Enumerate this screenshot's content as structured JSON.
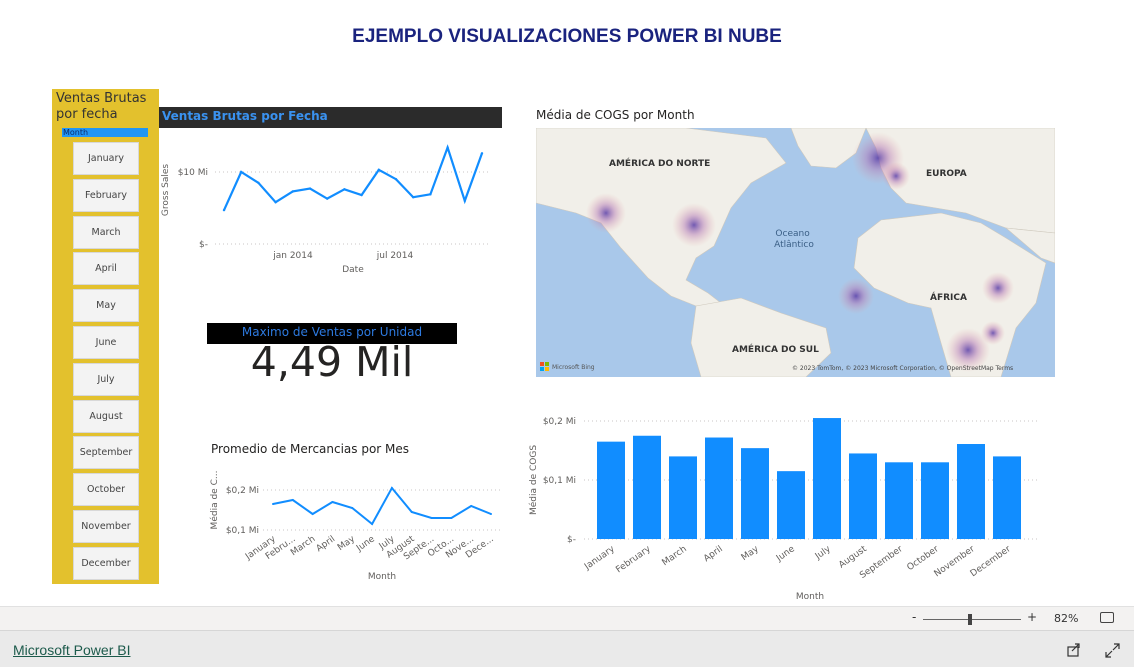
{
  "page_title": "EJEMPLO VISUALIZACIONES POWER BI NUBE",
  "slicer": {
    "title": "Ventas Brutas por fecha",
    "header": "Month",
    "items": [
      "January",
      "February",
      "March",
      "April",
      "May",
      "June",
      "July",
      "August",
      "September",
      "October",
      "November",
      "December"
    ]
  },
  "line_chart": {
    "title": "Ventas Brutas por Fecha",
    "ylabel": "Gross Sales",
    "xlabel": "Date",
    "y_ticks": [
      "$10 Mi",
      "$-"
    ],
    "x_ticks": [
      "jan 2014",
      "jul 2014"
    ]
  },
  "kpi": {
    "title": "Maximo de Ventas por Unidad",
    "value": "4,49 Mil"
  },
  "small_line": {
    "title": "Promedio de Mercancias por Mes",
    "ylabel": "Média de C...",
    "xlabel": "Month",
    "y_ticks": [
      "$0,2 Mi",
      "$0,1 Mi"
    ],
    "x_ticks": [
      "January",
      "Febru...",
      "March",
      "April",
      "May",
      "June",
      "July",
      "August",
      "Septe...",
      "Octo...",
      "Nove...",
      "Dece..."
    ]
  },
  "map": {
    "title": "Média de COGS por Month",
    "labels": {
      "north_america": "AMÉRICA DO NORTE",
      "europe": "EUROPA",
      "ocean": "Oceano Atlântico",
      "africa": "ÁFRICA",
      "south_america": "AMÉRICA DO SUL"
    },
    "bing": "Microsoft Bing",
    "attribution": "© 2023 TomTom, © 2023 Microsoft Corporation, © OpenStreetMap  Terms"
  },
  "bar_chart": {
    "ylabel": "Média de COGS",
    "xlabel": "Month",
    "y_ticks": [
      "$0,2 Mi",
      "$0,1 Mi",
      "$-"
    ]
  },
  "chart_data": [
    {
      "type": "line",
      "title": "Ventas Brutas por Fecha",
      "xlabel": "Date",
      "ylabel": "Gross Sales",
      "ylim": [
        0,
        14
      ],
      "x": [
        "2013-09",
        "2013-10",
        "2013-11",
        "2013-12",
        "2014-01",
        "2014-02",
        "2014-03",
        "2014-04",
        "2014-05",
        "2014-06",
        "2014-07",
        "2014-08",
        "2014-09",
        "2014-10",
        "2014-11",
        "2014-12",
        "2015-01"
      ],
      "values": [
        4.7,
        10.0,
        8.5,
        5.8,
        7.3,
        7.7,
        6.3,
        7.6,
        6.8,
        10.3,
        9.0,
        6.5,
        6.9,
        13.4,
        6.0,
        12.6
      ]
    },
    {
      "type": "line",
      "title": "Promedio de Mercancias por Mes",
      "xlabel": "Month",
      "ylabel": "Média de C...",
      "ylim": [
        0.08,
        0.22
      ],
      "categories": [
        "January",
        "February",
        "March",
        "April",
        "May",
        "June",
        "July",
        "August",
        "September",
        "October",
        "November",
        "December"
      ],
      "values": [
        0.165,
        0.175,
        0.14,
        0.17,
        0.155,
        0.115,
        0.205,
        0.145,
        0.13,
        0.13,
        0.16,
        0.14
      ]
    },
    {
      "type": "bar",
      "title": "",
      "xlabel": "Month",
      "ylabel": "Média de COGS",
      "ylim": [
        0,
        0.2
      ],
      "categories": [
        "January",
        "February",
        "March",
        "April",
        "May",
        "June",
        "July",
        "August",
        "September",
        "October",
        "November",
        "December"
      ],
      "values": [
        0.165,
        0.175,
        0.14,
        0.172,
        0.154,
        0.115,
        0.205,
        0.145,
        0.13,
        0.13,
        0.161,
        0.14
      ]
    }
  ],
  "zoom": {
    "minus": "-",
    "plus": "+",
    "level": "82%",
    "fraction": 0.48
  },
  "footer": {
    "brand": "Microsoft Power BI"
  },
  "colors": {
    "accent": "#118dff",
    "slicer_bg": "#e3c12d",
    "title": "#1a237e"
  }
}
